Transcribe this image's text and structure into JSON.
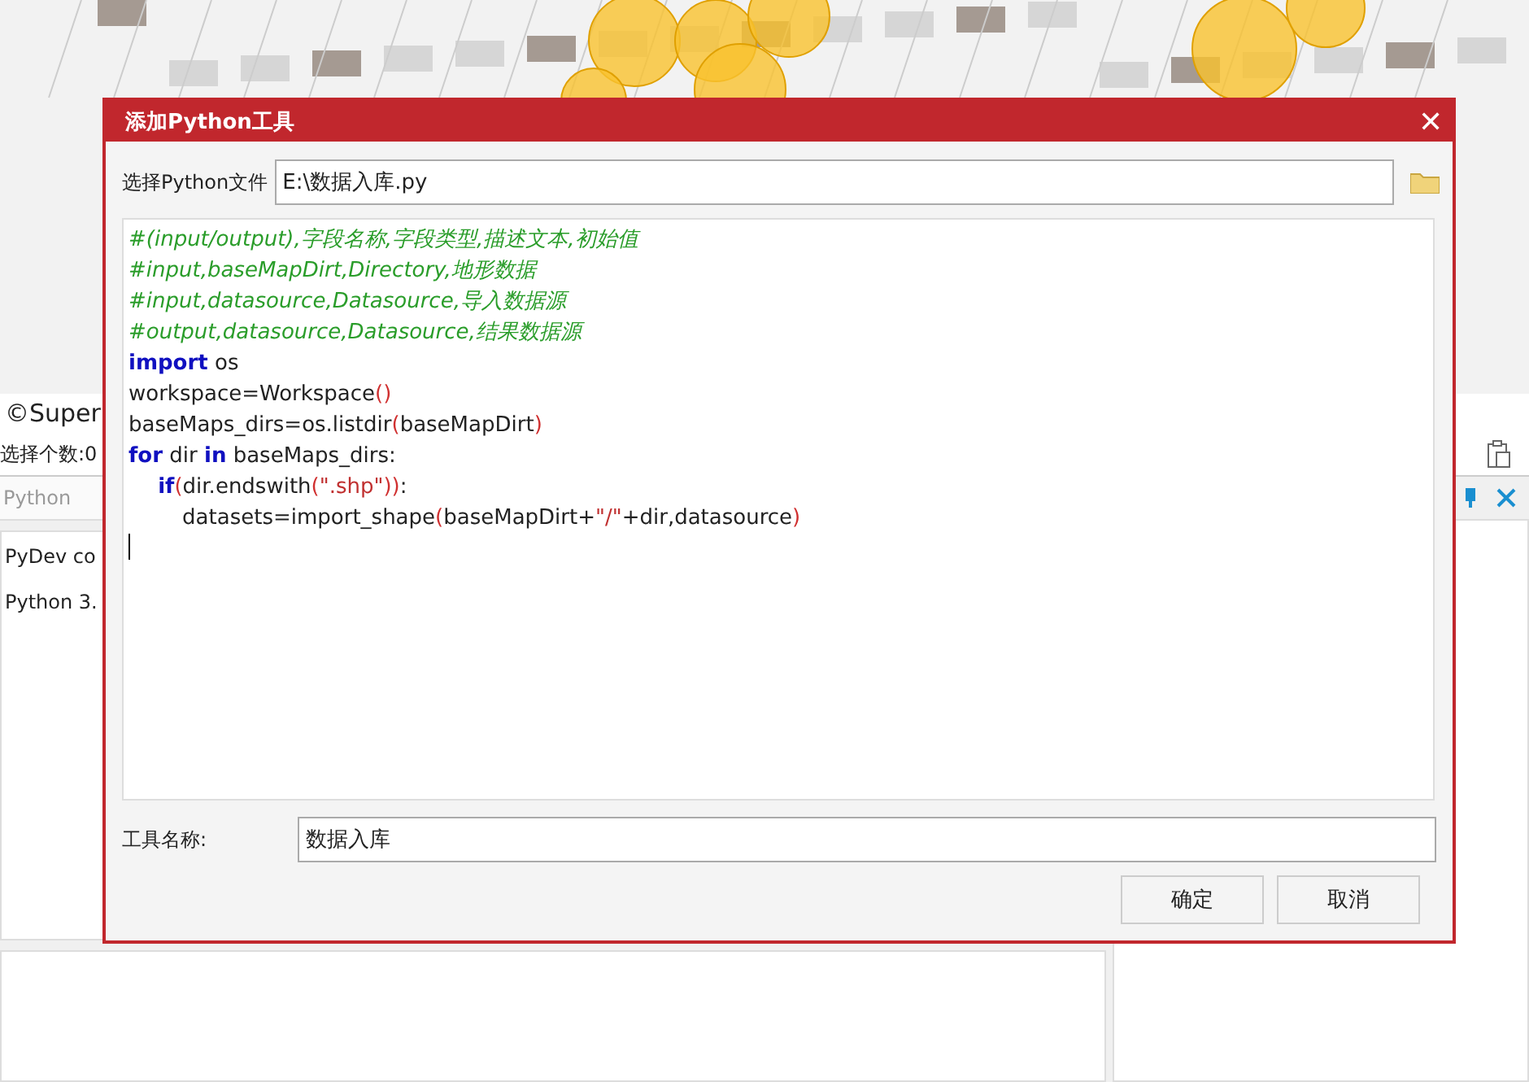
{
  "background": {
    "copyright": "©Super",
    "selection_count": "选择个数:0",
    "python_tab": "Python",
    "console_lines": [
      "PyDev co",
      "Python 3."
    ]
  },
  "dialog": {
    "title": "添加Python工具",
    "close": "✕",
    "file_label": "选择Python文件",
    "file_value": "E:\\数据入库.py",
    "code_lines": [
      [
        {
          "kind": "comment",
          "text": "#(input/output),字段名称,字段类型,描述文本,初始值"
        }
      ],
      [
        {
          "kind": "comment",
          "text": "#input,baseMapDirt,Directory,地形数据"
        }
      ],
      [
        {
          "kind": "comment",
          "text": "#input,datasource,Datasource,导入数据源"
        }
      ],
      [
        {
          "kind": "comment",
          "text": "#output,datasource,Datasource,结果数据源"
        }
      ],
      [
        {
          "kind": "keyword",
          "text": "import"
        },
        {
          "kind": "plain",
          "text": " os"
        }
      ],
      [
        {
          "kind": "plain",
          "text": "workspace=Workspace"
        },
        {
          "kind": "paren",
          "text": "()"
        }
      ],
      [
        {
          "kind": "plain",
          "text": "baseMaps_dirs=os.listdir"
        },
        {
          "kind": "paren",
          "text": "("
        },
        {
          "kind": "plain",
          "text": "baseMapDirt"
        },
        {
          "kind": "paren",
          "text": ")"
        }
      ],
      [
        {
          "kind": "keyword",
          "text": "for"
        },
        {
          "kind": "plain",
          "text": " dir "
        },
        {
          "kind": "keyword",
          "text": "in"
        },
        {
          "kind": "plain",
          "text": " baseMaps_dirs:"
        }
      ],
      [
        {
          "kind": "keyword",
          "text": "    if"
        },
        {
          "kind": "paren",
          "text": "("
        },
        {
          "kind": "plain",
          "text": "dir.endswith"
        },
        {
          "kind": "paren",
          "text": "("
        },
        {
          "kind": "string",
          "text": "\".shp\""
        },
        {
          "kind": "paren",
          "text": "))"
        },
        {
          "kind": "plain",
          "text": ":"
        }
      ],
      [
        {
          "kind": "plain",
          "text": "        datasets=import_shape"
        },
        {
          "kind": "paren",
          "text": "("
        },
        {
          "kind": "plain",
          "text": "baseMapDirt+"
        },
        {
          "kind": "string",
          "text": "\"/\""
        },
        {
          "kind": "plain",
          "text": "+dir,datasource"
        },
        {
          "kind": "paren",
          "text": ")"
        }
      ]
    ],
    "name_label": "工具名称:",
    "name_value": "数据入库",
    "buttons": [
      "确定",
      "取消"
    ]
  }
}
